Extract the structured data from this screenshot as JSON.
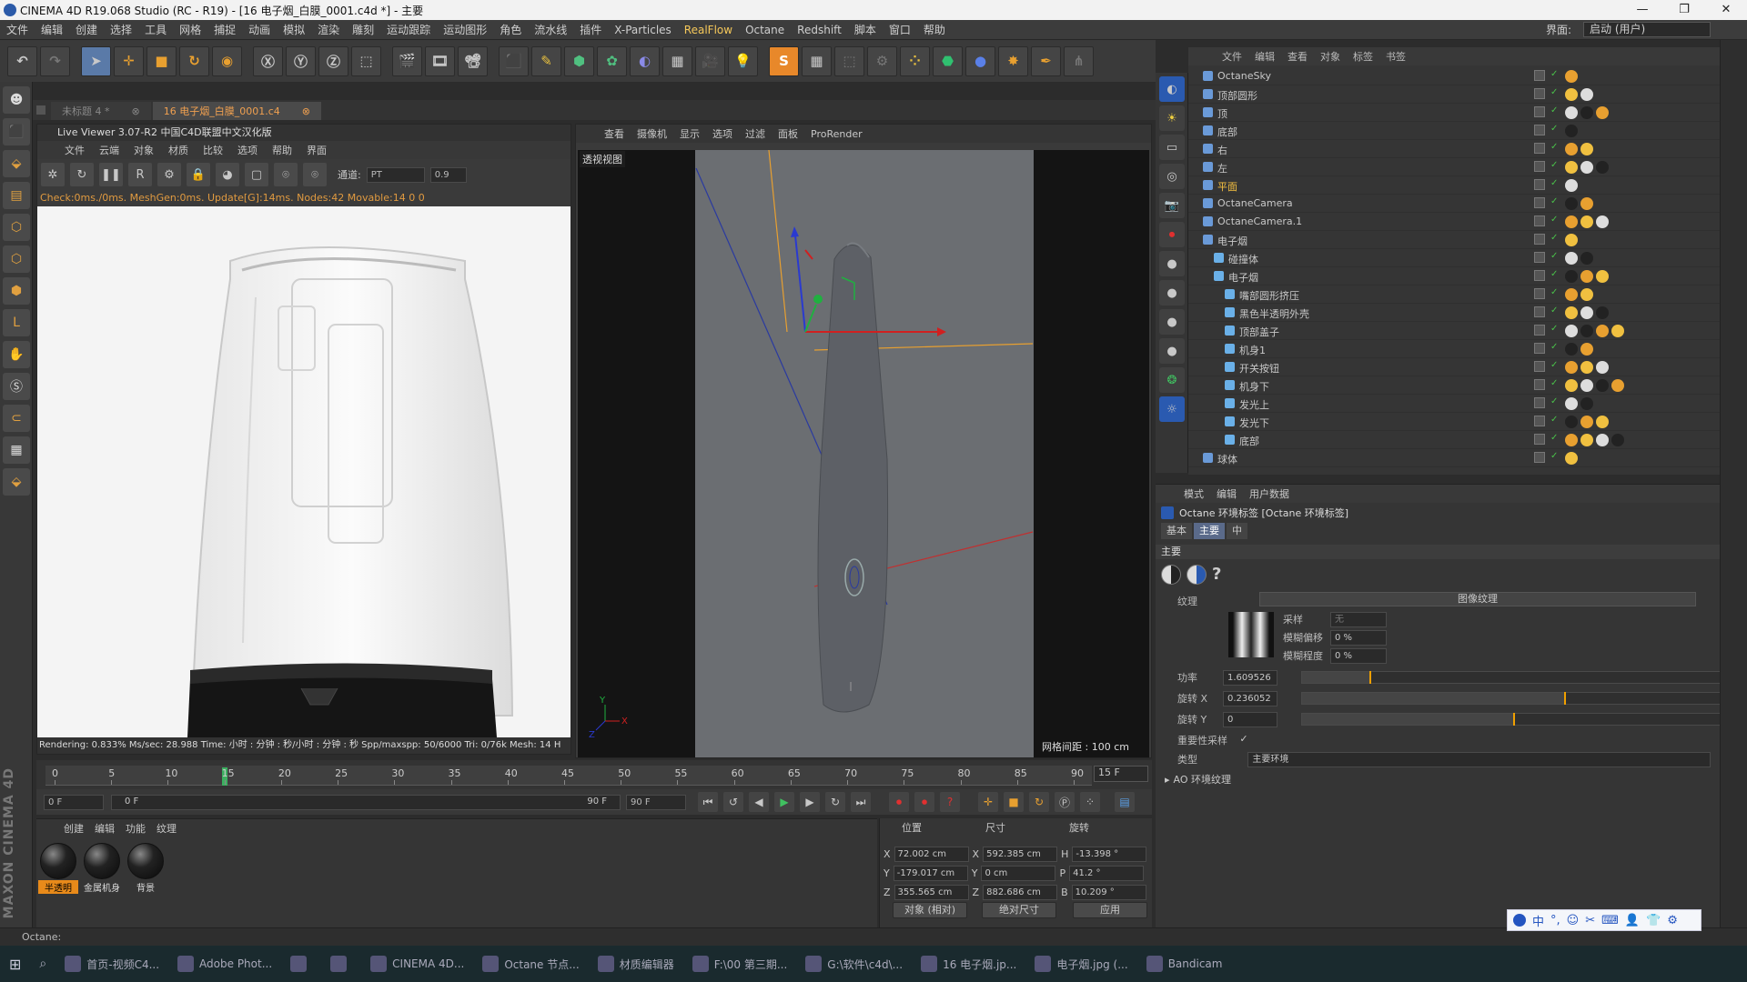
{
  "title": "CINEMA 4D R19.068 Studio (RC - R19) - [16 电子烟_白膜_0001.c4d *] - 主要",
  "menu": [
    "文件",
    "编辑",
    "创建",
    "选择",
    "工具",
    "网格",
    "捕捉",
    "动画",
    "模拟",
    "渲染",
    "雕刻",
    "运动跟踪",
    "运动图形",
    "角色",
    "流水线",
    "插件",
    "X-Particles",
    "RealFlow",
    "Octane",
    "Redshift",
    "脚本",
    "窗口",
    "帮助"
  ],
  "menu_highlight": "RealFlow",
  "interface_label": "界面:",
  "interface_value": "启动 (用户)",
  "doc_tabs": [
    {
      "label": "未标题 4 *",
      "active": false
    },
    {
      "label": "16 电子烟_白膜_0001.c4",
      "active": true
    }
  ],
  "live_viewer": {
    "title": "Live Viewer 3.07-R2 中国C4D联盟中文汉化版",
    "menu": [
      "文件",
      "云端",
      "对象",
      "材质",
      "比较",
      "选项",
      "帮助",
      "界面"
    ],
    "channel_label": "通道:",
    "channel_value": "PT",
    "channel_num": "0.9",
    "status": "Check:0ms./0ms. MeshGen:0ms. Update[G]:14ms. Nodes:42 Movable:14 0 0",
    "bottom": "Rendering: 0.833% Ms/sec: 28.988   Time: 小时 : 分钟 : 秒/小时 : 分钟 : 秒   Spp/maxspp: 50/6000   Tri: 0/76k   Mesh: 14   H"
  },
  "viewport": {
    "menu": [
      "查看",
      "摄像机",
      "显示",
      "选项",
      "过滤",
      "面板",
      "ProRender"
    ],
    "label": "透视视图",
    "grid": "网格间距 : 100 cm"
  },
  "timeline": {
    "ticks": [
      "0",
      "5",
      "10",
      "15",
      "20",
      "25",
      "30",
      "35",
      "40",
      "45",
      "50",
      "55",
      "60",
      "65",
      "70",
      "75",
      "80",
      "85",
      "90"
    ],
    "current_frame": 15,
    "end_frame_display": "15 F",
    "start_field": "0 F",
    "range_start": "0 F",
    "range_end": "90 F",
    "end_field": "90 F"
  },
  "materials": {
    "menu": [
      "创建",
      "编辑",
      "功能",
      "纹理"
    ],
    "items": [
      {
        "label": "半透明",
        "selected": true
      },
      {
        "label": "金属机身",
        "selected": false
      },
      {
        "label": "背景",
        "selected": false
      }
    ]
  },
  "coords": {
    "headers": [
      "位置",
      "尺寸",
      "旋转"
    ],
    "rows": [
      {
        "axis": "X",
        "pos": "72.002 cm",
        "size_axis": "X",
        "size": "592.385 cm",
        "rot_axis": "H",
        "rot": "-13.398 °"
      },
      {
        "axis": "Y",
        "pos": "-179.017 cm",
        "size_axis": "Y",
        "size": "0 cm",
        "rot_axis": "P",
        "rot": "41.2 °"
      },
      {
        "axis": "Z",
        "pos": "355.565 cm",
        "size_axis": "Z",
        "size": "882.686 cm",
        "rot_axis": "B",
        "rot": "10.209 °"
      }
    ],
    "btn_object": "对象 (相对)",
    "btn_size": "绝对尺寸",
    "btn_apply": "应用"
  },
  "objects": {
    "menu": [
      "文件",
      "编辑",
      "查看",
      "对象",
      "标签",
      "书签"
    ],
    "items": [
      {
        "name": "OctaneSky",
        "indent": 0,
        "hl": false
      },
      {
        "name": "顶部圆形",
        "indent": 0,
        "hl": false
      },
      {
        "name": "顶",
        "indent": 0,
        "hl": false
      },
      {
        "name": "底部",
        "indent": 0,
        "hl": false
      },
      {
        "name": "右",
        "indent": 0,
        "hl": false
      },
      {
        "name": "左",
        "indent": 0,
        "hl": false
      },
      {
        "name": "平面",
        "indent": 0,
        "hl": true
      },
      {
        "name": "OctaneCamera",
        "indent": 0,
        "hl": false
      },
      {
        "name": "OctaneCamera.1",
        "indent": 0,
        "hl": false
      },
      {
        "name": "电子烟",
        "indent": 0,
        "hl": false
      },
      {
        "name": "碰撞体",
        "indent": 1,
        "hl": false
      },
      {
        "name": "电子烟",
        "indent": 1,
        "hl": false
      },
      {
        "name": "嘴部圆形挤压",
        "indent": 2,
        "hl": false
      },
      {
        "name": "黑色半透明外壳",
        "indent": 2,
        "hl": false
      },
      {
        "name": "顶部盖子",
        "indent": 2,
        "hl": false
      },
      {
        "name": "机身1",
        "indent": 2,
        "hl": false
      },
      {
        "name": "开关按钮",
        "indent": 2,
        "hl": false
      },
      {
        "name": "机身下",
        "indent": 2,
        "hl": false
      },
      {
        "name": "发光上",
        "indent": 2,
        "hl": false
      },
      {
        "name": "发光下",
        "indent": 2,
        "hl": false
      },
      {
        "name": "底部",
        "indent": 2,
        "hl": false
      },
      {
        "name": "球体",
        "indent": 0,
        "hl": false
      }
    ]
  },
  "attributes": {
    "menu": [
      "模式",
      "编辑",
      "用户数据"
    ],
    "title": "Octane 环境标签 [Octane 环境标签]",
    "tabs": [
      {
        "label": "基本",
        "active": false
      },
      {
        "label": "主要",
        "active": true
      },
      {
        "label": "中",
        "active": false
      }
    ],
    "section": "主要",
    "texture_label": "纹理",
    "texture_btn": "图像纹理",
    "sample_label": "采样",
    "sample_value": "无",
    "blur_offset_label": "模糊偏移",
    "blur_offset_value": "0 %",
    "blur_level_label": "模糊程度",
    "blur_level_value": "0 %",
    "power_label": "功率",
    "power_value": "1.609526",
    "power_level": 0.16,
    "rotx_label": "旋转 X",
    "rotx_value": "0.236052",
    "rotx_level": 0.62,
    "roty_label": "旋转 Y",
    "roty_value": "0",
    "roty_level": 0.5,
    "importance_label": "重要性采样",
    "importance_check": "✓",
    "type_label": "类型",
    "type_value": "主要环境",
    "ao_label": "AO 环境纹理"
  },
  "status_text": "Octane:",
  "taskbar": [
    "首页-视频C4...",
    "Adobe Phot...",
    "",
    "",
    "CINEMA 4D...",
    "Octane 节点...",
    "材质编辑器",
    "F:\\00 第三期...",
    "G:\\软件\\c4d\\...",
    "16 电子烟.jp...",
    "电子烟.jpg (...",
    "Bandicam"
  ],
  "ime": [
    "中",
    "°,",
    "☺",
    "✂",
    "⌨",
    "👤",
    "👕",
    "⚙"
  ]
}
